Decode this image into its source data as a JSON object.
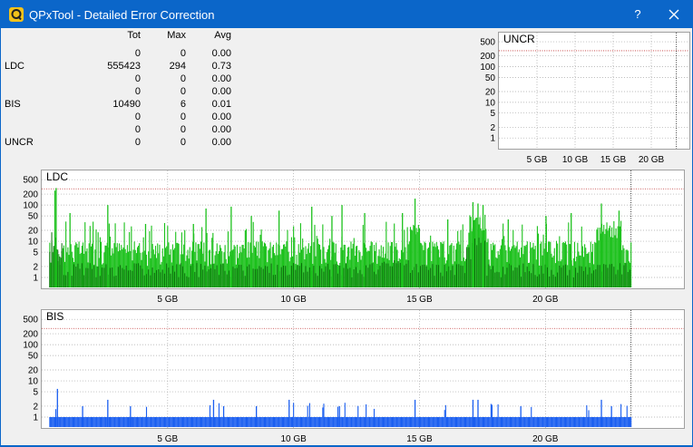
{
  "window": {
    "title": "QPxTool - Detailed Error Correction",
    "help_label": "?"
  },
  "colors": {
    "titlebar": "#0b66c9",
    "ldc_light": "#1cc11c",
    "ldc_dark": "#0a6a0a",
    "bis": "#1a5ef0",
    "threshold": "#c03030",
    "grid": "#a8a8a8"
  },
  "icons": {
    "app": "qpxtool-app-icon",
    "close": "close-icon"
  },
  "stats": {
    "headers": [
      "Tot",
      "Max",
      "Avg"
    ],
    "rows": [
      {
        "label": "",
        "tot": "0",
        "max": "0",
        "avg": "0.00"
      },
      {
        "label": "LDC",
        "tot": "555423",
        "max": "294",
        "avg": "0.73"
      },
      {
        "label": "",
        "tot": "0",
        "max": "0",
        "avg": "0.00"
      },
      {
        "label": "",
        "tot": "0",
        "max": "0",
        "avg": "0.00"
      },
      {
        "label": "BIS",
        "tot": "10490",
        "max": "6",
        "avg": "0.01"
      },
      {
        "label": "",
        "tot": "0",
        "max": "0",
        "avg": "0.00"
      },
      {
        "label": "",
        "tot": "0",
        "max": "0",
        "avg": "0.00"
      },
      {
        "label": "UNCR",
        "tot": "0",
        "max": "0",
        "avg": "0.00"
      }
    ]
  },
  "chart_data": [
    {
      "type": "bar",
      "title": "UNCR",
      "yscale": "log",
      "y_ticks": [
        1,
        2,
        5,
        10,
        20,
        50,
        100,
        200,
        500
      ],
      "x_ticks": [
        "5 GB",
        "10 GB",
        "15 GB",
        "20 GB"
      ],
      "x_tick_values": [
        5,
        10,
        15,
        20
      ],
      "xlim": [
        0,
        25
      ],
      "data_end": 23.3,
      "threshold": 280,
      "grid": true,
      "values": []
    },
    {
      "type": "bar",
      "title": "LDC",
      "yscale": "log",
      "y_ticks": [
        1,
        2,
        5,
        10,
        20,
        50,
        100,
        200,
        500
      ],
      "x_ticks": [
        "5 GB",
        "10 GB",
        "15 GB",
        "20 GB"
      ],
      "x_tick_values": [
        5,
        10,
        15,
        20
      ],
      "xlim": [
        0,
        25.5
      ],
      "data_end": 23.4,
      "threshold": 280,
      "grid": true,
      "typical": 6,
      "max": 294,
      "spikes": [
        [
          0.5,
          250
        ],
        [
          0.55,
          294
        ],
        [
          1.1,
          60
        ],
        [
          2.6,
          100
        ],
        [
          4.1,
          30
        ],
        [
          6.0,
          30
        ],
        [
          6.5,
          80
        ],
        [
          7.5,
          90
        ],
        [
          8.3,
          50
        ],
        [
          9.4,
          70
        ],
        [
          10.7,
          90
        ],
        [
          11.5,
          50
        ],
        [
          11.9,
          100
        ],
        [
          12.8,
          60
        ],
        [
          14.3,
          60
        ],
        [
          14.8,
          150
        ],
        [
          16.1,
          40
        ],
        [
          17.1,
          120
        ],
        [
          17.3,
          110
        ],
        [
          17.5,
          100
        ],
        [
          18.5,
          40
        ],
        [
          20.0,
          50
        ],
        [
          21.0,
          60
        ],
        [
          22.2,
          110
        ],
        [
          22.9,
          70
        ]
      ]
    },
    {
      "type": "bar",
      "title": "BIS",
      "yscale": "log",
      "y_ticks": [
        1,
        2,
        5,
        10,
        20,
        50,
        100,
        200,
        500
      ],
      "x_ticks": [
        "5 GB",
        "10 GB",
        "15 GB",
        "20 GB"
      ],
      "x_tick_values": [
        5,
        10,
        15,
        20
      ],
      "xlim": [
        0,
        25.5
      ],
      "data_end": 23.4,
      "threshold": 280,
      "grid": true,
      "typical": 1,
      "max": 6,
      "spikes": [
        [
          0.6,
          6
        ],
        [
          1.6,
          2
        ],
        [
          2.6,
          3
        ],
        [
          3.5,
          2
        ],
        [
          6.8,
          3
        ],
        [
          7.2,
          2
        ],
        [
          8.5,
          2
        ],
        [
          9.8,
          3
        ],
        [
          11.8,
          2
        ],
        [
          14.8,
          3
        ],
        [
          17.1,
          3
        ],
        [
          17.3,
          3
        ],
        [
          19.0,
          2
        ],
        [
          22.2,
          3
        ],
        [
          22.6,
          2
        ]
      ]
    }
  ]
}
